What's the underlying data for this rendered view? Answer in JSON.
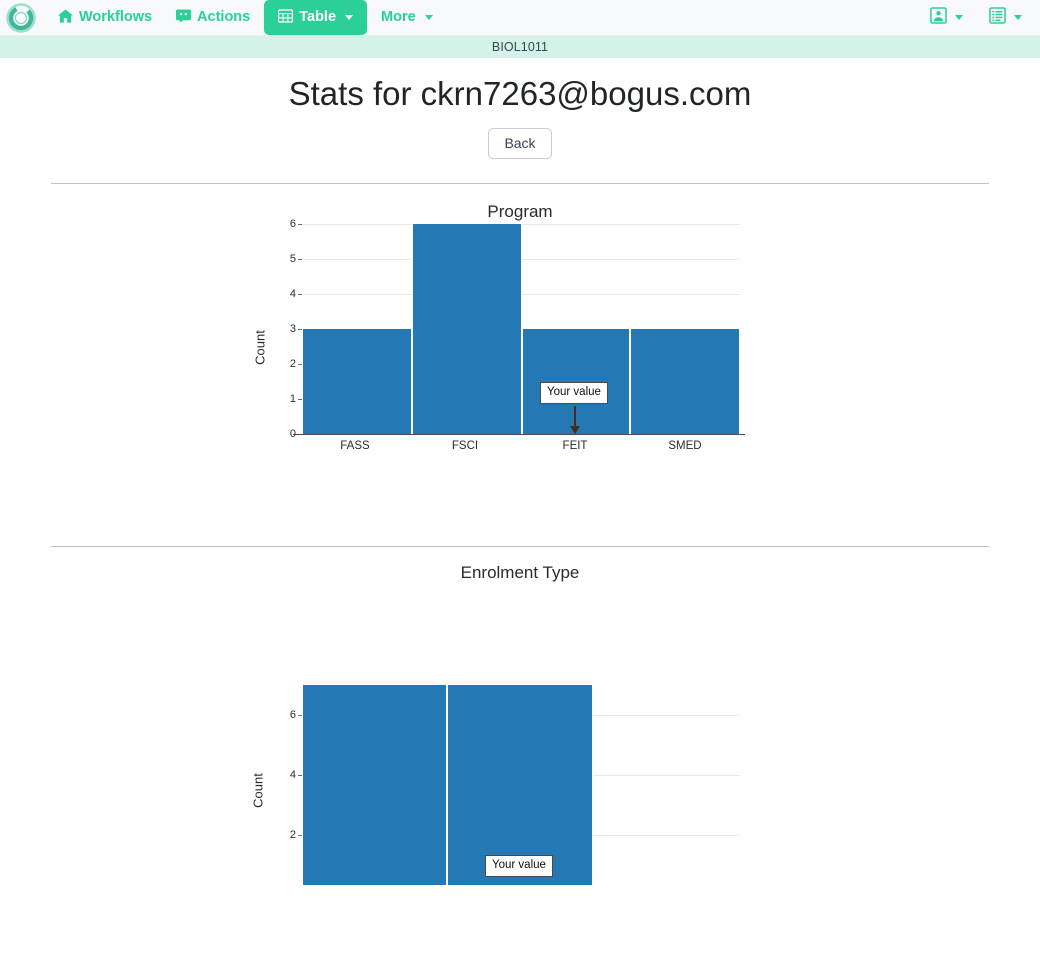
{
  "navbar": {
    "logo_icon": "ontask-ring-logo",
    "items": [
      {
        "label": "Workflows",
        "icon": "home-icon",
        "has_caret": false,
        "active": false
      },
      {
        "label": "Actions",
        "icon": "comment-icon",
        "has_caret": false,
        "active": false
      },
      {
        "label": "Table",
        "icon": "table-grid-icon",
        "has_caret": true,
        "active": true
      },
      {
        "label": "More",
        "icon": null,
        "has_caret": true,
        "active": false
      }
    ],
    "right_items": [
      {
        "icon": "user-card-icon",
        "has_caret": true
      },
      {
        "icon": "list-document-icon",
        "has_caret": true
      }
    ],
    "accent_color": "#2bcf98",
    "background": "#f8f9fa"
  },
  "course_bar": {
    "label": "BIOL1011",
    "background": "#d4f2e7"
  },
  "header": {
    "title": "Stats for ckrn7263@bogus.com",
    "back_label": "Back"
  },
  "chart_data": [
    {
      "type": "bar",
      "title": "Program",
      "categories": [
        "FASS",
        "FSCI",
        "FEIT",
        "SMED"
      ],
      "values": [
        3,
        6,
        3,
        3
      ],
      "xlabel": "",
      "ylabel": "Count",
      "ylim": [
        0,
        6
      ],
      "yticks": [
        0,
        1,
        2,
        3,
        4,
        5,
        6
      ],
      "grid": true,
      "bar_color": "#2478b4",
      "annotation": {
        "text": "Your value",
        "category": "FEIT"
      }
    },
    {
      "type": "bar",
      "title": "Enrolment Type",
      "categories": [
        "",
        ""
      ],
      "values": [
        7,
        7
      ],
      "xlabel": "",
      "ylabel": "Count",
      "ylim": [
        0,
        7
      ],
      "yticks": [
        2,
        4,
        6
      ],
      "grid": true,
      "bar_color": "#2478b4",
      "annotation": {
        "text": "Your value",
        "category": ""
      }
    }
  ]
}
